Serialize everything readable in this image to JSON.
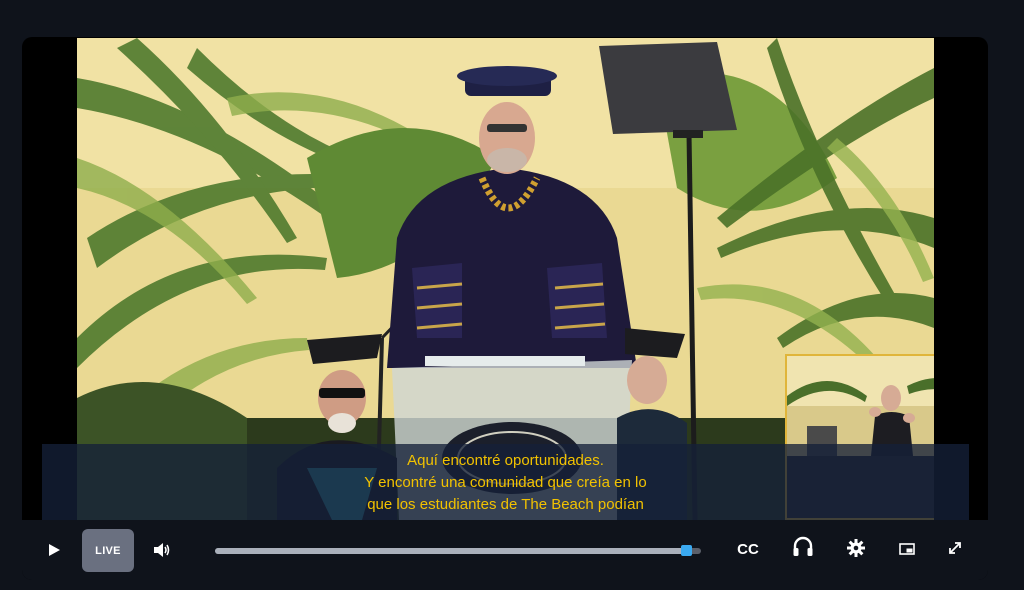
{
  "player": {
    "captions": {
      "lines": [
        "Aquí encontré oportunidades.",
        "Y encontré una comunidad que creía en lo",
        "que los estudiantes de The Beach podían"
      ],
      "color": "#f2c200"
    },
    "controls": {
      "play_icon": "play-icon",
      "live_label": "LIVE",
      "volume_icon": "volume-icon",
      "progress_fraction": 0.97,
      "cc_label": "CC",
      "headset_icon": "headphones-icon",
      "settings_icon": "gear-icon",
      "pip_icon": "picture-in-picture-icon",
      "fullscreen_icon": "fullscreen-icon"
    },
    "colors": {
      "accent": "#3aa9f0",
      "caption_bg": "#142038",
      "pip_border": "#e0b53a"
    }
  }
}
